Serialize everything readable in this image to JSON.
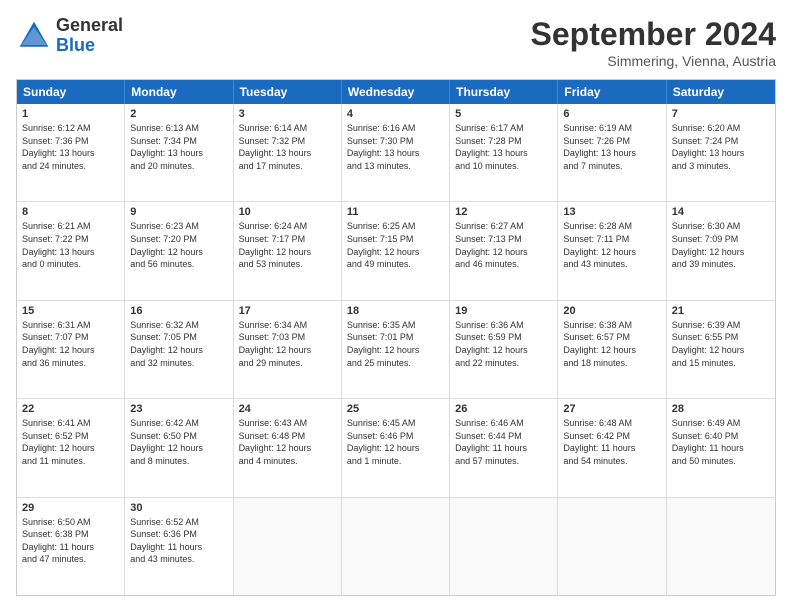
{
  "logo": {
    "general": "General",
    "blue": "Blue"
  },
  "title": "September 2024",
  "location": "Simmering, Vienna, Austria",
  "days": [
    "Sunday",
    "Monday",
    "Tuesday",
    "Wednesday",
    "Thursday",
    "Friday",
    "Saturday"
  ],
  "rows": [
    [
      {
        "day": "1",
        "lines": [
          "Sunrise: 6:12 AM",
          "Sunset: 7:36 PM",
          "Daylight: 13 hours",
          "and 24 minutes."
        ]
      },
      {
        "day": "2",
        "lines": [
          "Sunrise: 6:13 AM",
          "Sunset: 7:34 PM",
          "Daylight: 13 hours",
          "and 20 minutes."
        ]
      },
      {
        "day": "3",
        "lines": [
          "Sunrise: 6:14 AM",
          "Sunset: 7:32 PM",
          "Daylight: 13 hours",
          "and 17 minutes."
        ]
      },
      {
        "day": "4",
        "lines": [
          "Sunrise: 6:16 AM",
          "Sunset: 7:30 PM",
          "Daylight: 13 hours",
          "and 13 minutes."
        ]
      },
      {
        "day": "5",
        "lines": [
          "Sunrise: 6:17 AM",
          "Sunset: 7:28 PM",
          "Daylight: 13 hours",
          "and 10 minutes."
        ]
      },
      {
        "day": "6",
        "lines": [
          "Sunrise: 6:19 AM",
          "Sunset: 7:26 PM",
          "Daylight: 13 hours",
          "and 7 minutes."
        ]
      },
      {
        "day": "7",
        "lines": [
          "Sunrise: 6:20 AM",
          "Sunset: 7:24 PM",
          "Daylight: 13 hours",
          "and 3 minutes."
        ]
      }
    ],
    [
      {
        "day": "8",
        "lines": [
          "Sunrise: 6:21 AM",
          "Sunset: 7:22 PM",
          "Daylight: 13 hours",
          "and 0 minutes."
        ]
      },
      {
        "day": "9",
        "lines": [
          "Sunrise: 6:23 AM",
          "Sunset: 7:20 PM",
          "Daylight: 12 hours",
          "and 56 minutes."
        ]
      },
      {
        "day": "10",
        "lines": [
          "Sunrise: 6:24 AM",
          "Sunset: 7:17 PM",
          "Daylight: 12 hours",
          "and 53 minutes."
        ]
      },
      {
        "day": "11",
        "lines": [
          "Sunrise: 6:25 AM",
          "Sunset: 7:15 PM",
          "Daylight: 12 hours",
          "and 49 minutes."
        ]
      },
      {
        "day": "12",
        "lines": [
          "Sunrise: 6:27 AM",
          "Sunset: 7:13 PM",
          "Daylight: 12 hours",
          "and 46 minutes."
        ]
      },
      {
        "day": "13",
        "lines": [
          "Sunrise: 6:28 AM",
          "Sunset: 7:11 PM",
          "Daylight: 12 hours",
          "and 43 minutes."
        ]
      },
      {
        "day": "14",
        "lines": [
          "Sunrise: 6:30 AM",
          "Sunset: 7:09 PM",
          "Daylight: 12 hours",
          "and 39 minutes."
        ]
      }
    ],
    [
      {
        "day": "15",
        "lines": [
          "Sunrise: 6:31 AM",
          "Sunset: 7:07 PM",
          "Daylight: 12 hours",
          "and 36 minutes."
        ]
      },
      {
        "day": "16",
        "lines": [
          "Sunrise: 6:32 AM",
          "Sunset: 7:05 PM",
          "Daylight: 12 hours",
          "and 32 minutes."
        ]
      },
      {
        "day": "17",
        "lines": [
          "Sunrise: 6:34 AM",
          "Sunset: 7:03 PM",
          "Daylight: 12 hours",
          "and 29 minutes."
        ]
      },
      {
        "day": "18",
        "lines": [
          "Sunrise: 6:35 AM",
          "Sunset: 7:01 PM",
          "Daylight: 12 hours",
          "and 25 minutes."
        ]
      },
      {
        "day": "19",
        "lines": [
          "Sunrise: 6:36 AM",
          "Sunset: 6:59 PM",
          "Daylight: 12 hours",
          "and 22 minutes."
        ]
      },
      {
        "day": "20",
        "lines": [
          "Sunrise: 6:38 AM",
          "Sunset: 6:57 PM",
          "Daylight: 12 hours",
          "and 18 minutes."
        ]
      },
      {
        "day": "21",
        "lines": [
          "Sunrise: 6:39 AM",
          "Sunset: 6:55 PM",
          "Daylight: 12 hours",
          "and 15 minutes."
        ]
      }
    ],
    [
      {
        "day": "22",
        "lines": [
          "Sunrise: 6:41 AM",
          "Sunset: 6:52 PM",
          "Daylight: 12 hours",
          "and 11 minutes."
        ]
      },
      {
        "day": "23",
        "lines": [
          "Sunrise: 6:42 AM",
          "Sunset: 6:50 PM",
          "Daylight: 12 hours",
          "and 8 minutes."
        ]
      },
      {
        "day": "24",
        "lines": [
          "Sunrise: 6:43 AM",
          "Sunset: 6:48 PM",
          "Daylight: 12 hours",
          "and 4 minutes."
        ]
      },
      {
        "day": "25",
        "lines": [
          "Sunrise: 6:45 AM",
          "Sunset: 6:46 PM",
          "Daylight: 12 hours",
          "and 1 minute."
        ]
      },
      {
        "day": "26",
        "lines": [
          "Sunrise: 6:46 AM",
          "Sunset: 6:44 PM",
          "Daylight: 11 hours",
          "and 57 minutes."
        ]
      },
      {
        "day": "27",
        "lines": [
          "Sunrise: 6:48 AM",
          "Sunset: 6:42 PM",
          "Daylight: 11 hours",
          "and 54 minutes."
        ]
      },
      {
        "day": "28",
        "lines": [
          "Sunrise: 6:49 AM",
          "Sunset: 6:40 PM",
          "Daylight: 11 hours",
          "and 50 minutes."
        ]
      }
    ],
    [
      {
        "day": "29",
        "lines": [
          "Sunrise: 6:50 AM",
          "Sunset: 6:38 PM",
          "Daylight: 11 hours",
          "and 47 minutes."
        ]
      },
      {
        "day": "30",
        "lines": [
          "Sunrise: 6:52 AM",
          "Sunset: 6:36 PM",
          "Daylight: 11 hours",
          "and 43 minutes."
        ]
      },
      {
        "day": "",
        "lines": []
      },
      {
        "day": "",
        "lines": []
      },
      {
        "day": "",
        "lines": []
      },
      {
        "day": "",
        "lines": []
      },
      {
        "day": "",
        "lines": []
      }
    ]
  ]
}
